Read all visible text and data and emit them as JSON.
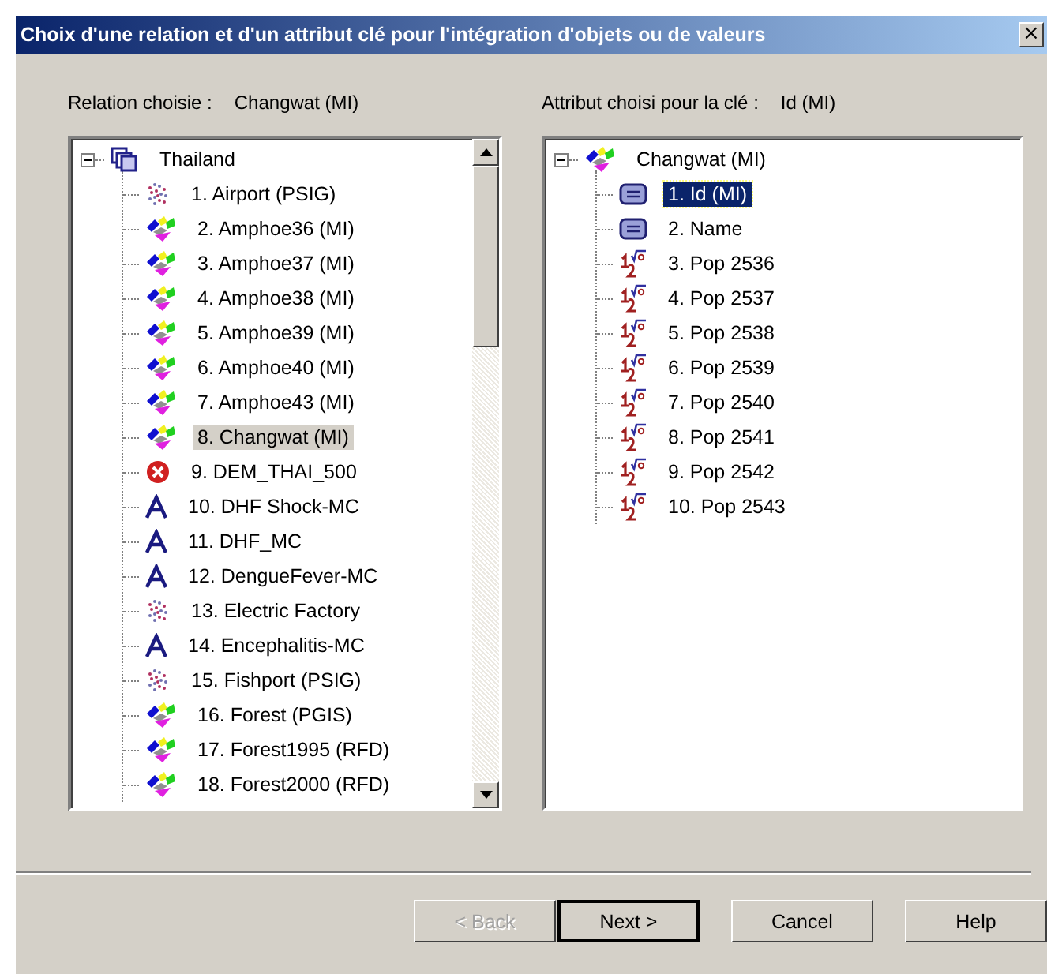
{
  "window": {
    "title": "Choix d'une relation et d'un attribut clé pour l'intégration d'objets ou de valeurs",
    "close": "×"
  },
  "relation": {
    "label": "Relation choisie :",
    "value": "Changwat (MI)"
  },
  "attribute": {
    "label": "Attribut choisi pour la clé :",
    "value": "Id (MI)"
  },
  "relation_tree": {
    "label": "Thailand",
    "kind": "database",
    "expanded": true,
    "children": [
      {
        "label": "1. Airport (PSIG)",
        "kind": "points",
        "selected": false
      },
      {
        "label": "2. Amphoe36 (MI)",
        "kind": "regions",
        "selected": false
      },
      {
        "label": "3. Amphoe37 (MI)",
        "kind": "regions",
        "selected": false
      },
      {
        "label": "4. Amphoe38 (MI)",
        "kind": "regions",
        "selected": false
      },
      {
        "label": "5. Amphoe39 (MI)",
        "kind": "regions",
        "selected": false
      },
      {
        "label": "6. Amphoe40 (MI)",
        "kind": "regions",
        "selected": false
      },
      {
        "label": "7. Amphoe43 (MI)",
        "kind": "regions",
        "selected": false
      },
      {
        "label": "8. Changwat (MI)",
        "kind": "regions",
        "selected": true
      },
      {
        "label": "9. DEM_THAI_500",
        "kind": "error",
        "selected": false
      },
      {
        "label": "10. DHF Shock-MC",
        "kind": "text",
        "selected": false
      },
      {
        "label": "11. DHF_MC",
        "kind": "text",
        "selected": false
      },
      {
        "label": "12. DengueFever-MC",
        "kind": "text",
        "selected": false
      },
      {
        "label": "13. Electric Factory",
        "kind": "points",
        "selected": false
      },
      {
        "label": "14. Encephalitis-MC",
        "kind": "text",
        "selected": false
      },
      {
        "label": "15. Fishport (PSIG)",
        "kind": "points",
        "selected": false
      },
      {
        "label": "16. Forest (PGIS)",
        "kind": "regions",
        "selected": false
      },
      {
        "label": "17. Forest1995 (RFD)",
        "kind": "regions",
        "selected": false
      },
      {
        "label": "18. Forest2000 (RFD)",
        "kind": "regions",
        "selected": false
      }
    ]
  },
  "attribute_tree": {
    "label": "Changwat (MI)",
    "kind": "regions",
    "expanded": true,
    "children": [
      {
        "label": "1. Id (MI)",
        "kind": "string",
        "selected": true
      },
      {
        "label": "2. Name",
        "kind": "string",
        "selected": false
      },
      {
        "label": "3. Pop 2536",
        "kind": "number",
        "selected": false
      },
      {
        "label": "4. Pop 2537",
        "kind": "number",
        "selected": false
      },
      {
        "label": "5. Pop 2538",
        "kind": "number",
        "selected": false
      },
      {
        "label": "6. Pop 2539",
        "kind": "number",
        "selected": false
      },
      {
        "label": "7. Pop 2540",
        "kind": "number",
        "selected": false
      },
      {
        "label": "8. Pop 2541",
        "kind": "number",
        "selected": false
      },
      {
        "label": "9. Pop 2542",
        "kind": "number",
        "selected": false
      },
      {
        "label": "10. Pop 2543",
        "kind": "number",
        "selected": false
      }
    ]
  },
  "buttons": [
    {
      "label": "< Back",
      "disabled": true,
      "default": false
    },
    {
      "label": "Next >",
      "disabled": false,
      "default": true
    },
    {
      "label": "Cancel",
      "disabled": false,
      "default": false
    },
    {
      "label": "Help",
      "disabled": false,
      "default": false
    }
  ]
}
